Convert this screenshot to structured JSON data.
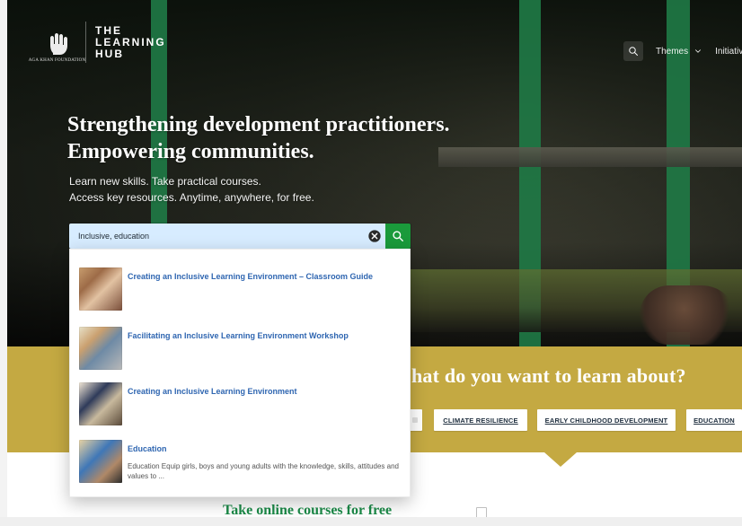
{
  "brand": {
    "org_name": "AGA KHAN FOUNDATION",
    "hub_line1": "THE",
    "hub_line2": "LEARNING",
    "hub_line3": "HUB"
  },
  "topnav": {
    "themes_label": "Themes",
    "initiatives_label": "Initiativ"
  },
  "hero": {
    "headline_line1": "Strengthening development practitioners.",
    "headline_line2": "Empowering communities.",
    "sub_line1": "Learn new skills. Take practical courses.",
    "sub_line2": "Access key resources. Anytime, anywhere, for free."
  },
  "search": {
    "value": "Inclusive, education",
    "placeholder": ""
  },
  "results": [
    {
      "title": "Creating an Inclusive Learning Environment – Classroom Guide",
      "description": ""
    },
    {
      "title": "Facilitating an Inclusive Learning Environment Workshop",
      "description": ""
    },
    {
      "title": "Creating an Inclusive Learning Environment",
      "description": ""
    },
    {
      "title": "Education",
      "description": "Education Equip girls, boys and young adults with the knowledge, skills, attitudes and values to ..."
    }
  ],
  "learn": {
    "title": "hat do you want to learn about?",
    "categories": [
      "CLIMATE RESILIENCE",
      "EARLY CHILDHOOD DEVELOPMENT",
      "EDUCATION"
    ]
  },
  "lower": {
    "title": "Take online courses for free"
  },
  "colors": {
    "gold": "#c4a942",
    "green": "#1a9a3b",
    "link_blue": "#2f66b1"
  }
}
